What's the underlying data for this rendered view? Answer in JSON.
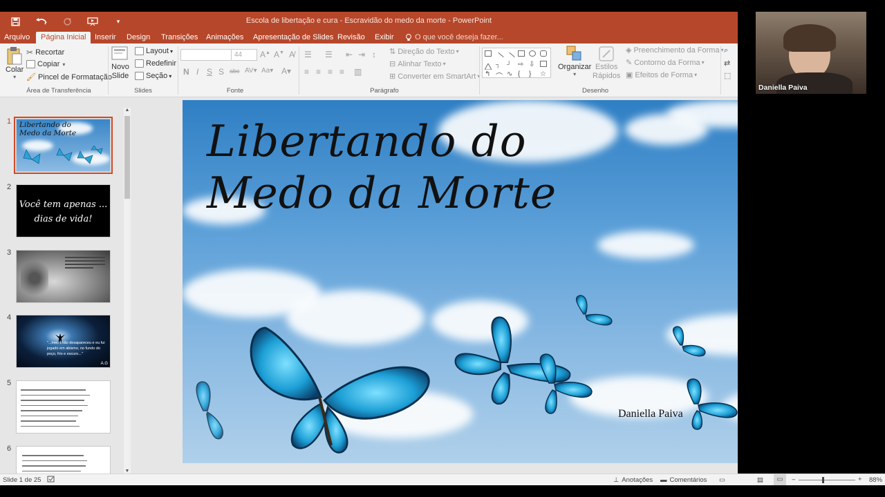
{
  "window": {
    "title": "Escola de libertação e cura - Escravidão do medo da morte - PowerPoint",
    "qat_icons": [
      "save-icon",
      "undo-icon",
      "redo-icon",
      "start-from-beginning-icon",
      "customize-qat-icon"
    ]
  },
  "tabs": [
    {
      "label": "Arquivo"
    },
    {
      "label": "Página Inicial"
    },
    {
      "label": "Inserir"
    },
    {
      "label": "Design"
    },
    {
      "label": "Transições"
    },
    {
      "label": "Animações"
    },
    {
      "label": "Apresentação de Slides"
    },
    {
      "label": "Revisão"
    },
    {
      "label": "Exibir"
    }
  ],
  "tell_me": "O que você deseja fazer...",
  "ribbon": {
    "clipboard": {
      "paste": "Colar",
      "cut": "Recortar",
      "copy": "Copiar",
      "format_painter": "Pincel de Formatação",
      "label": "Área de Transferência"
    },
    "slides": {
      "new_slide_1": "Novo",
      "new_slide_2": "Slide",
      "layout": "Layout",
      "reset": "Redefinir",
      "section": "Seção",
      "label": "Slides"
    },
    "font": {
      "size": "44",
      "label": "Fonte"
    },
    "paragraph": {
      "text_direction": "Direção do Texto",
      "align_text": "Alinhar Texto",
      "smartart": "Converter em SmartArt",
      "label": "Parágrafo"
    },
    "drawing": {
      "arrange": "Organizar",
      "quick_styles_1": "Estilos",
      "quick_styles_2": "Rápidos",
      "shape_fill": "Preenchimento da Forma",
      "shape_outline": "Contorno da Forma",
      "shape_effects": "Efeitos de Forma",
      "label": "Desenho"
    }
  },
  "thumbnails": [
    {
      "num": "1",
      "text_1": "Libertando do",
      "text_2": "Medo da Morte"
    },
    {
      "num": "2",
      "text_1": "Você tem apenas ...",
      "text_2": "dias de vida!"
    },
    {
      "num": "3"
    },
    {
      "num": "4",
      "text_1": "\"...meu chão desapareceu e eu fui",
      "text_2": "jogado em abismo, no fundo do",
      "text_3": "poço, frio e escuro...\"",
      "text_4": "A.G"
    },
    {
      "num": "5"
    },
    {
      "num": "6"
    }
  ],
  "slide": {
    "title_line_1": "Libertando do",
    "title_line_2": "Medo da Morte",
    "subtitle": "Daniella Paiva"
  },
  "status": {
    "slide_info": "Slide 1 de 25",
    "notes": "Anotações",
    "comments": "Comentários",
    "zoom": "88%"
  },
  "webcam": {
    "name": "Daniella Paiva"
  },
  "colors": {
    "accent": "#b7472a",
    "selected_outline": "#d24726"
  }
}
